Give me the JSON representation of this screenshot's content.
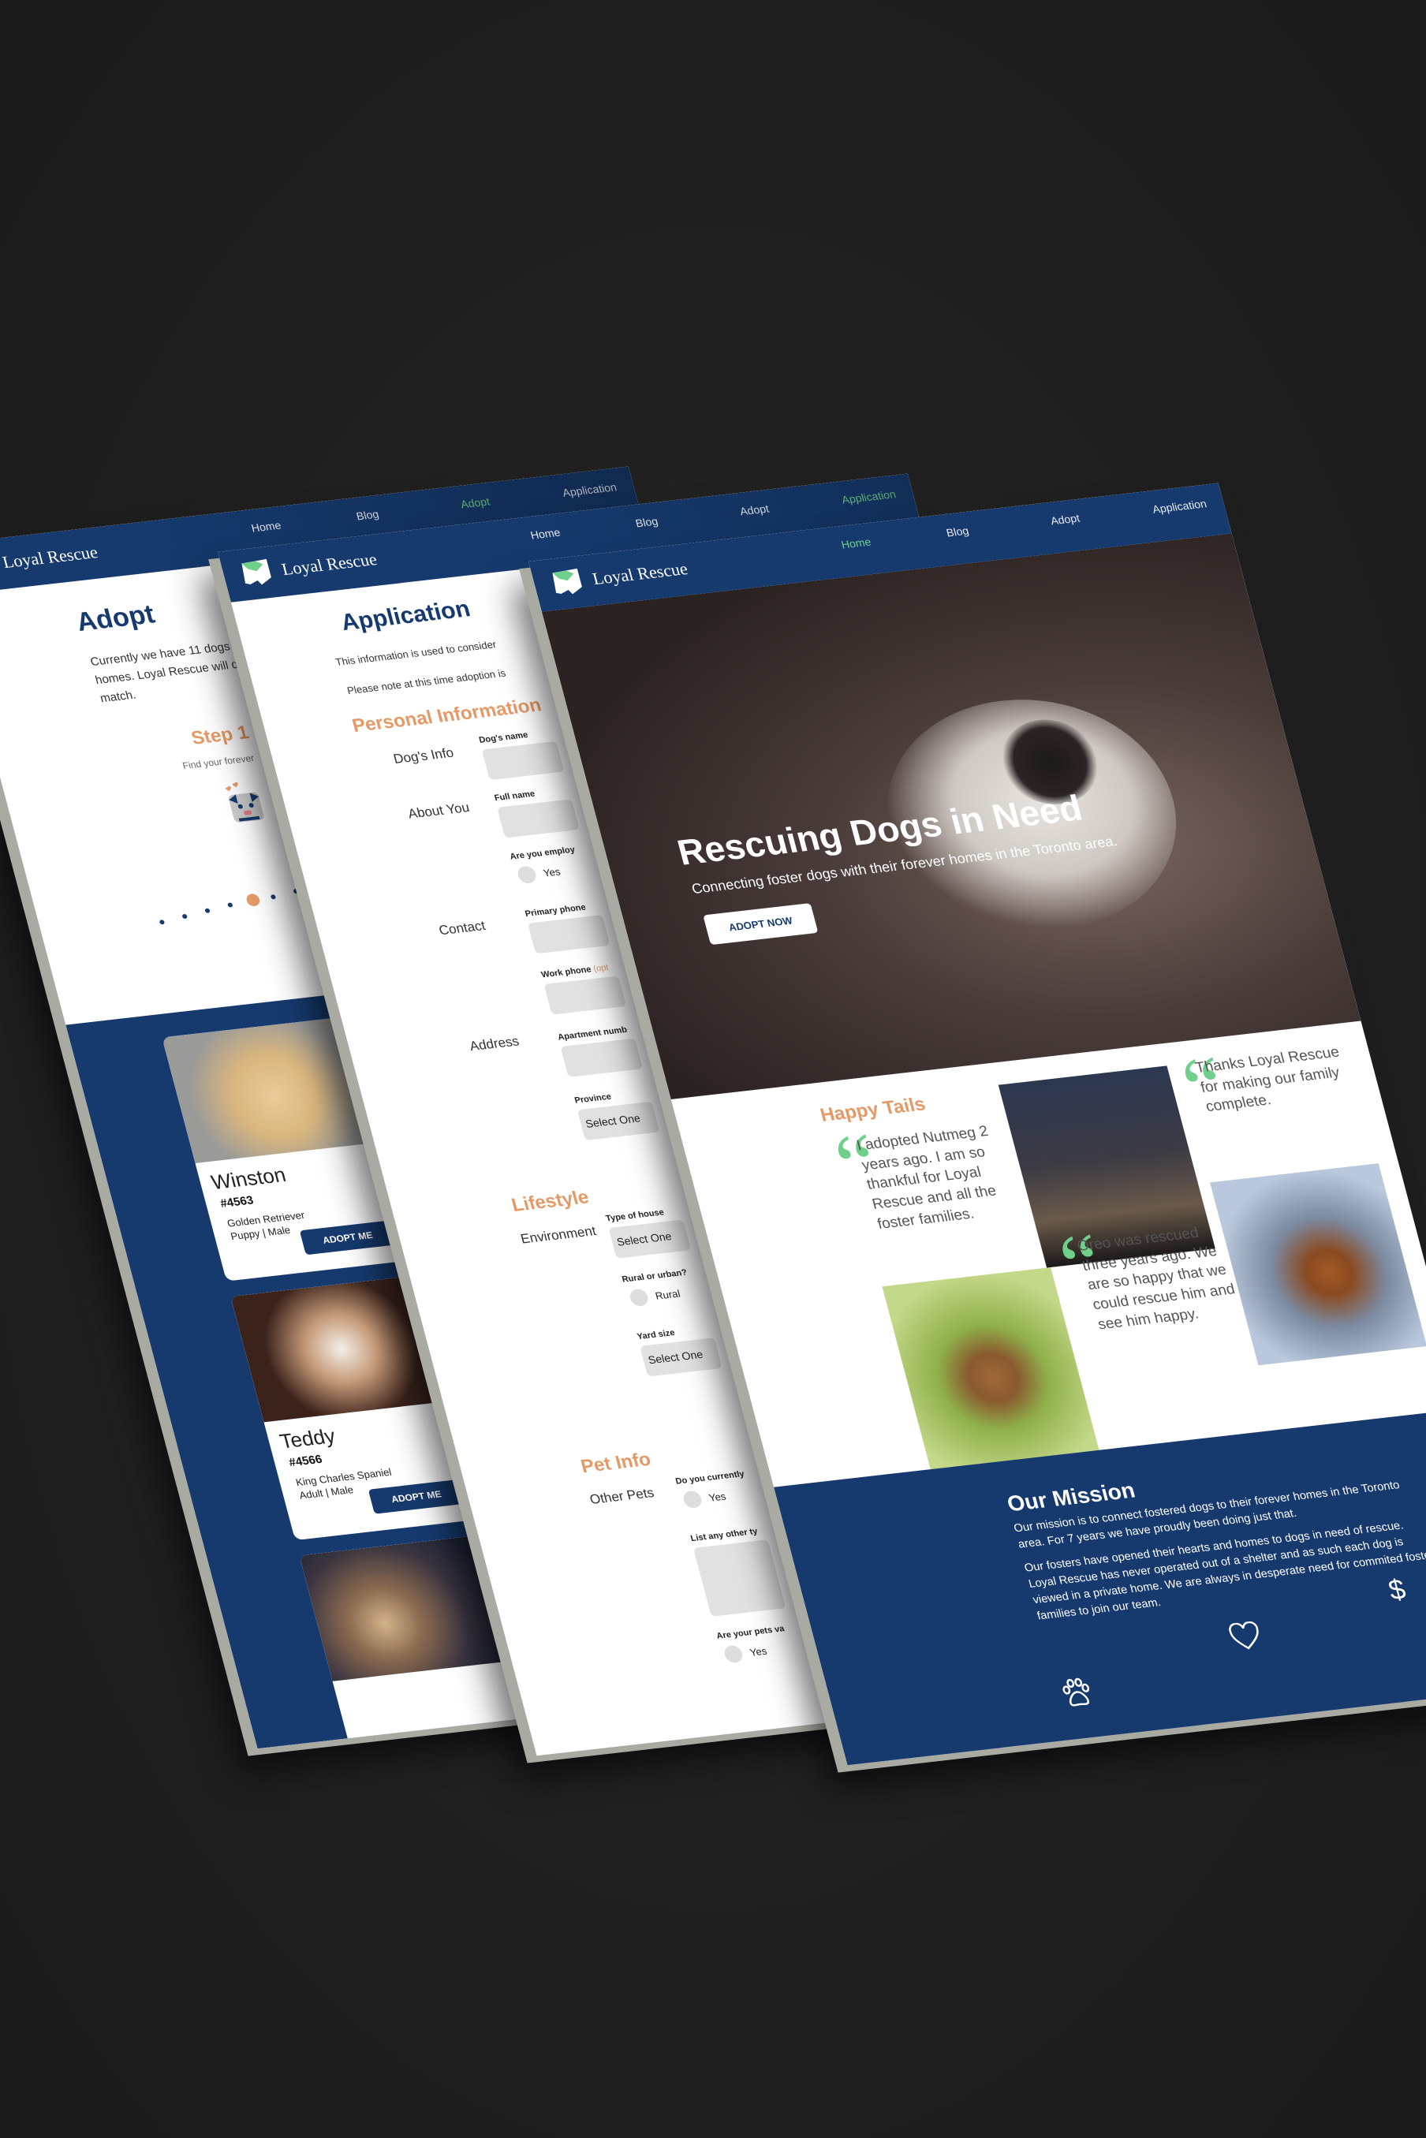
{
  "brand": {
    "name": "Loyal Rescue",
    "navy": "#163a6e",
    "green": "#6fd08c",
    "orange": "#e49a67"
  },
  "nav": {
    "items": [
      "Home",
      "Blog",
      "Adopt",
      "Application"
    ]
  },
  "adopt_page": {
    "active_nav": "Adopt",
    "title": "Adopt",
    "intro": [
      "Currently we have 11 dogs up for a",
      "homes. Loyal Rescue will do all w",
      "match."
    ],
    "step": {
      "title": "Step 1",
      "text": "Find your forever",
      "icon": "pug-heart-icon"
    },
    "carousel": {
      "count": 7,
      "active_index": 4
    },
    "dogs": [
      {
        "name": "Winston",
        "id": "#4563",
        "breed": "Golden Retriever",
        "details": "Puppy | Male",
        "button": "ADOPT ME"
      },
      {
        "name": "Teddy",
        "id": "#4566",
        "breed": "King Charles Spaniel",
        "details": "Adult | Male",
        "button": "ADOPT ME"
      },
      {
        "name": "",
        "id": "",
        "breed": "",
        "details": "",
        "button": ""
      }
    ]
  },
  "application_page": {
    "active_nav": "Application",
    "title": "Application",
    "intro": [
      "This information is used to consider",
      "Please note at this time adoption is"
    ],
    "sections": {
      "personal": "Personal Information",
      "lifestyle": "Lifestyle",
      "pet_info": "Pet Info"
    },
    "groups": {
      "dogs_info": "Dog's Info",
      "about_you": "About You",
      "contact": "Contact",
      "address": "Address",
      "environment": "Environment",
      "other_pets": "Other Pets"
    },
    "fields": {
      "dogs_name": "Dog's name",
      "full_name": "Full name",
      "employed": "Are you employ",
      "employed_option": "Yes",
      "primary_phone": "Primary phone",
      "work_phone": "Work phone",
      "work_phone_note": "(opt",
      "apartment": "Apartment numb",
      "province": "Province",
      "province_value": "Select One",
      "house_type": "Type of house",
      "house_type_value": "Select One",
      "rural_urban": "Rural or urban?",
      "rural_option": "Rural",
      "yard_size": "Yard size",
      "yard_size_value": "Select One",
      "current_pets": "Do you currently",
      "current_pets_option": "Yes",
      "other_types": "List any other ty",
      "pets_vaccinated": "Are your pets va",
      "pets_vaccinated_option": "Yes"
    }
  },
  "home_page": {
    "active_nav": "Home",
    "hero": {
      "title": "Rescuing Dogs in Need",
      "subtitle": "Connecting foster dogs with their forever homes in the Toronto area.",
      "button": "ADOPT NOW"
    },
    "happy_tails": {
      "title": "Happy Tails",
      "quotes": [
        "I adopted Nutmeg 2 years ago. I am so thankful for Loyal Rescue and all the foster families.",
        "Thanks Loyal Rescue for making our family complete.",
        "Oreo was rescued three years ago. We are so happy that we could rescue him and see him happy."
      ]
    },
    "mission": {
      "title": "Our Mission",
      "paragraphs": [
        "Our mission is to connect fostered dogs to their forever homes in the Toronto area. For 7 years we have proudly been doing just that.",
        "Our fosters have opened their hearts and homes to dogs in need of rescue. Loyal Rescue has never operated out of a shelter and as such each dog is viewed in a private home. We are always in desperate need for commited foster families to join our team."
      ],
      "icons": [
        "paw-icon",
        "heart-icon",
        "dollar-icon"
      ]
    }
  }
}
